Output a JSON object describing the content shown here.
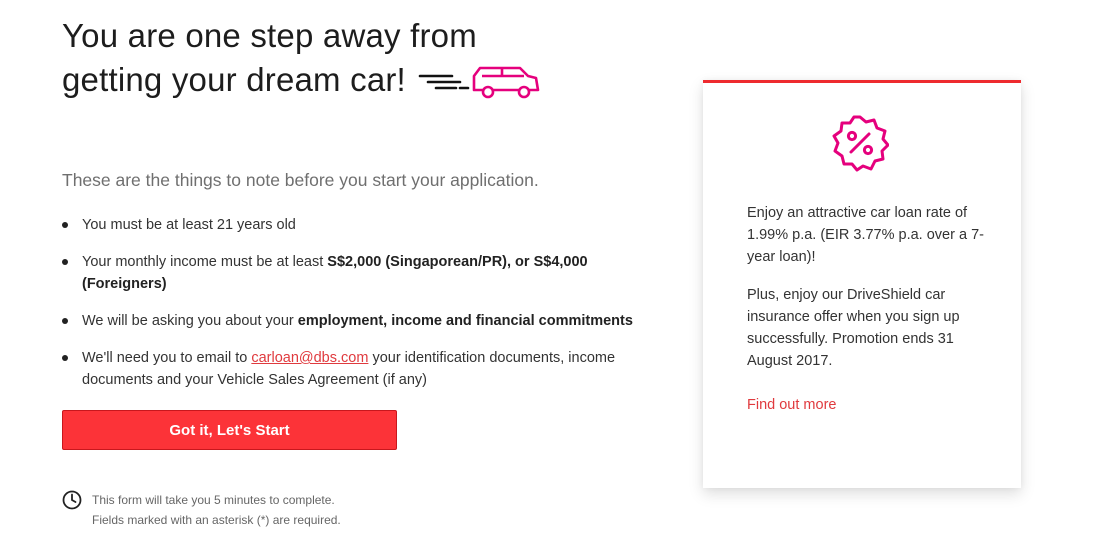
{
  "hero": {
    "title_line1": "You are one step away from",
    "title_line2": "getting your dream car!",
    "car_icon": "car-speed-icon",
    "accent_color": "#e5007d"
  },
  "intro": "These are the things to note before you start your application.",
  "notes": [
    {
      "text_1": "You must be at least 21 years old"
    },
    {
      "text_1": "Your monthly income must be at least ",
      "bold_1": "S$2,000 (Singaporean/PR), or S$4,000 (Foreigners)"
    },
    {
      "text_1": "We will be asking you about your ",
      "bold_1": "employment, income and financial commitments"
    },
    {
      "text_1": "We'll need you to email to ",
      "link": "carloan@dbs.com",
      "text_2": " your identification documents, income documents and your Vehicle Sales Agreement (if any)"
    }
  ],
  "cta": {
    "label": "Got it, Let's Start",
    "color": "#fc3338"
  },
  "footnote": {
    "icon": "clock-icon",
    "line1": "This form will take you 5 minutes to complete.",
    "line2": "Fields marked with an asterisk (*) are required."
  },
  "promo": {
    "icon": "percent-badge-icon",
    "paragraph1": "Enjoy an attractive car loan rate of 1.99% p.a. (EIR 3.77% p.a. over a 7-year loan)!",
    "paragraph2": "Plus, enjoy our DriveShield car insurance offer when you sign up successfully. Promotion ends 31 August 2017.",
    "link_label": "Find out more",
    "border_color": "#ee2a2f"
  }
}
